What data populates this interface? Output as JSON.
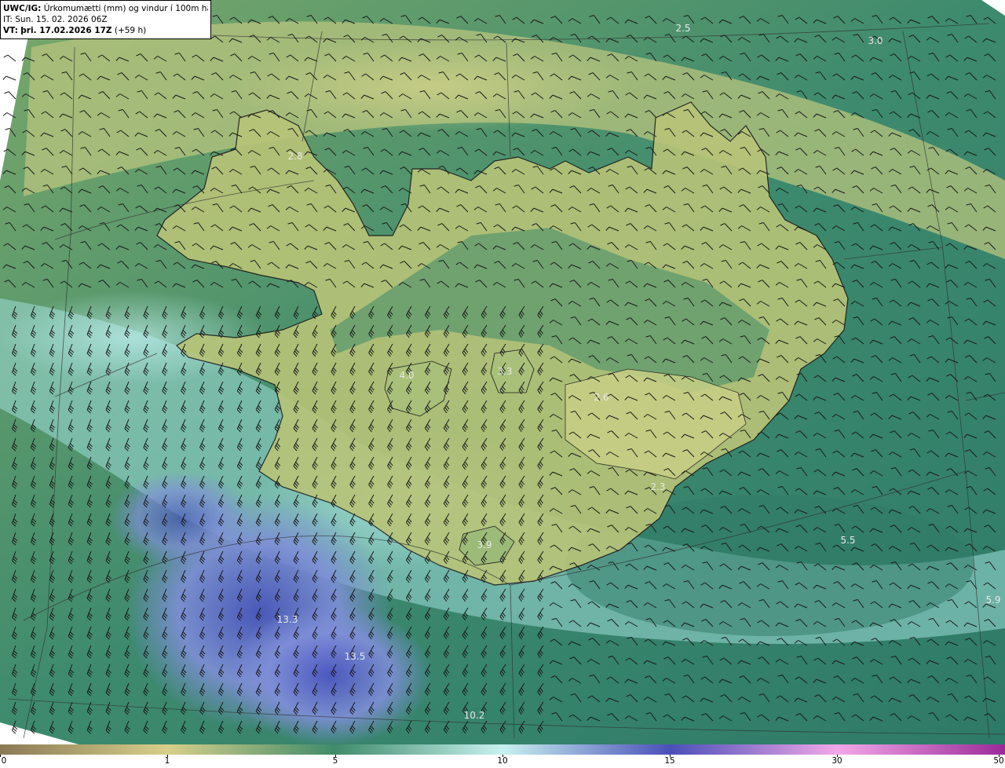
{
  "header": {
    "model": "UWC/IG:",
    "title": "Úrkomumætti (mm) og vindur í 100m hæð",
    "it_label": "IT:",
    "it_value": "Sun. 15. 02. 2026 06Z",
    "vt_label": "VT:",
    "vt_value": "þri. 17.02.2026 17Z",
    "vt_lead": "(+59 h)"
  },
  "value_labels": [
    "2.5",
    "3.0",
    "2.8",
    "4.0",
    "3.3",
    "2.6",
    "2.3",
    "3.9",
    "5.5",
    "5.9",
    "13.3",
    "13.5",
    "10.2"
  ],
  "colorbar": {
    "ticks": [
      "0",
      "1",
      "5",
      "10",
      "15",
      "30",
      "50"
    ],
    "colors": [
      "#8a7a55",
      "#d8cf8a",
      "#3f8b6a",
      "#c8f2f0",
      "#4a4fb8",
      "#f2a8e8",
      "#9a2a9a"
    ]
  }
}
